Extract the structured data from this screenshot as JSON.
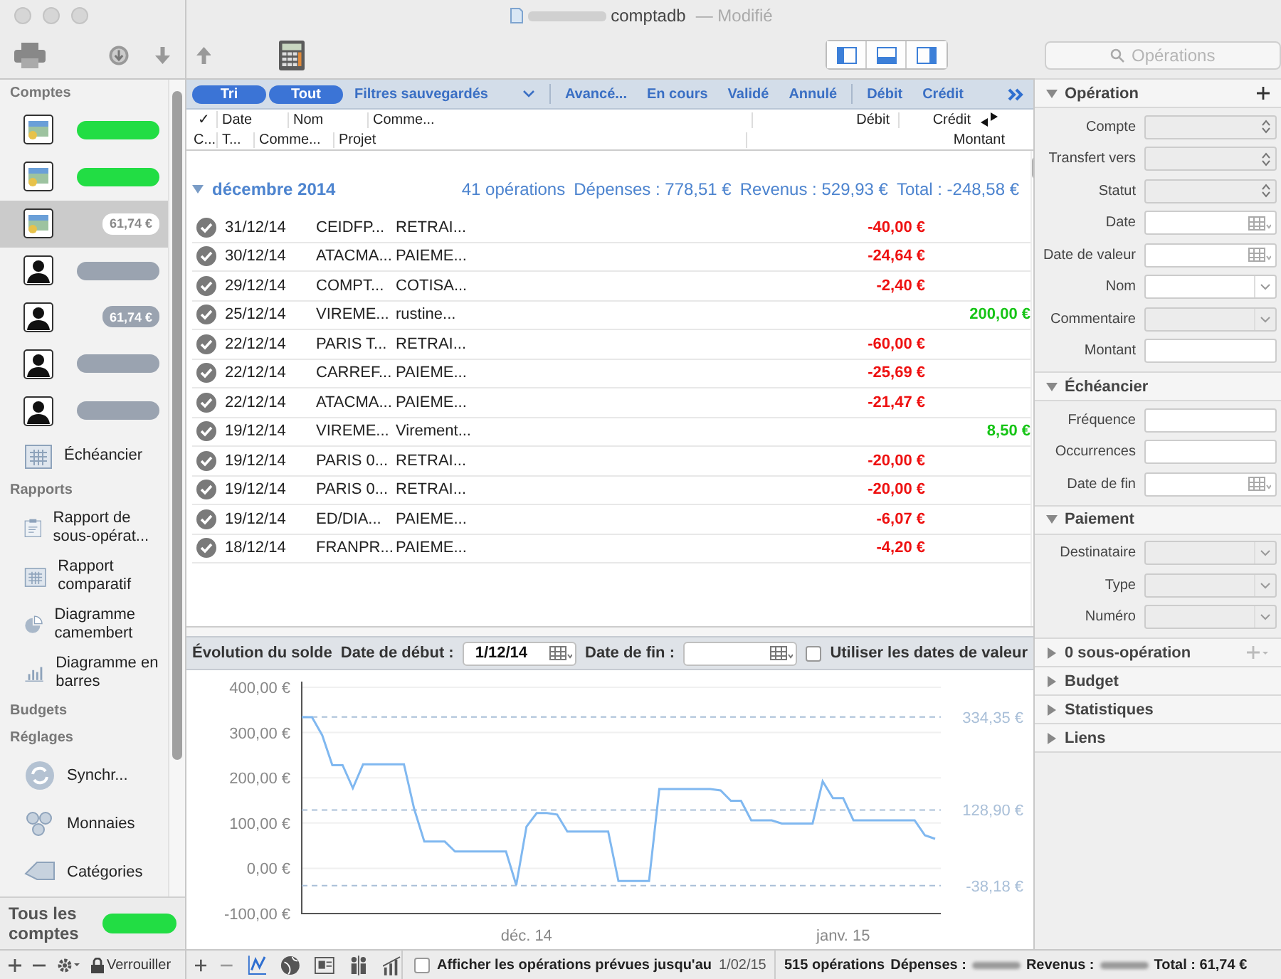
{
  "window": {
    "title": "comptadb",
    "status": "— Modifié"
  },
  "toolbar": {
    "search": {
      "placeholder": "Opérations"
    }
  },
  "sidebar": {
    "accounts_heading": "Comptes",
    "accounts": [
      {
        "kind": "card",
        "color": "#22dd44",
        "selected": false
      },
      {
        "kind": "card",
        "color": "#22dd44",
        "selected": false
      },
      {
        "kind": "card",
        "color": "#ffffff",
        "amount": "61,74 €",
        "selected": true
      },
      {
        "kind": "person",
        "color": "#9aa3b0",
        "selected": false
      },
      {
        "kind": "person",
        "color": "#9aa3b0",
        "amount": "61,74 €",
        "selected": false
      },
      {
        "kind": "person",
        "color": "#9aa3b0",
        "selected": false
      },
      {
        "kind": "person",
        "color": "#9aa3b0",
        "selected": false
      }
    ],
    "schedule": {
      "label": "Échéancier"
    },
    "groups": [
      {
        "heading": "Rapports",
        "items": [
          {
            "kind": "clipboard",
            "label": "Rapport de sous-opérat..."
          },
          {
            "kind": "calendar",
            "label": "Rapport comparatif"
          },
          {
            "kind": "pie",
            "label": "Diagramme camembert"
          },
          {
            "kind": "bars",
            "label": "Diagramme en barres"
          }
        ]
      },
      {
        "heading": "Budgets"
      },
      {
        "heading": "Réglages",
        "items": [
          {
            "kind": "sync",
            "label": "Synchr..."
          },
          {
            "kind": "coins",
            "label": "Monnaies"
          },
          {
            "kind": "tag",
            "label": "Catégories"
          }
        ]
      }
    ],
    "all_accounts": {
      "label": "Tous les comptes",
      "color": "#22dd44"
    },
    "lock_label": "Verrouiller"
  },
  "filters": [
    {
      "kind": "pill",
      "label": "Tri",
      "selected": true
    },
    {
      "kind": "pill",
      "label": "Tout",
      "selected": true
    },
    {
      "kind": "menu",
      "label": "Filtres sauvegardés",
      "selected": false
    },
    {
      "kind": "text",
      "label": "Avancé...",
      "selected": false
    },
    {
      "kind": "text",
      "label": "En cours",
      "selected": false
    },
    {
      "kind": "text",
      "label": "Validé",
      "selected": false
    },
    {
      "kind": "text",
      "label": "Annulé",
      "selected": false
    },
    {
      "kind": "text",
      "label": "Débit",
      "selected": false
    },
    {
      "kind": "text",
      "label": "Crédit",
      "selected": false
    }
  ],
  "table": {
    "header_row_1": [
      "✓",
      "Date",
      "Nom",
      "Comme...",
      "Débit",
      "Crédit"
    ],
    "header_row_2": [
      "C...",
      "T...",
      "Comme...",
      "Projet",
      "Montant"
    ],
    "group": {
      "label": "décembre 2014",
      "expanded": true,
      "count": "41 opérations",
      "expenses": "Dépenses : 778,51 €",
      "income": "Revenus : 529,93 €",
      "total": "Total : -248,58 €"
    },
    "rows": [
      {
        "validated": true,
        "date": "31/12/14",
        "name": "CEIDFP...",
        "comment": "RETRAI...",
        "debit": "-40,00 €"
      },
      {
        "validated": true,
        "date": "30/12/14",
        "name": "ATACMA...",
        "comment": "PAIEME...",
        "debit": "-24,64 €"
      },
      {
        "validated": true,
        "date": "29/12/14",
        "name": "COMPT...",
        "comment": "COTISA...",
        "debit": "-2,40 €"
      },
      {
        "validated": true,
        "date": "25/12/14",
        "name": "VIREME...",
        "comment": "rustine...",
        "credit": "200,00 €"
      },
      {
        "validated": true,
        "date": "22/12/14",
        "name": "PARIS T...",
        "comment": "RETRAI...",
        "debit": "-60,00 €"
      },
      {
        "validated": true,
        "date": "22/12/14",
        "name": "CARREF...",
        "comment": "PAIEME...",
        "debit": "-25,69 €"
      },
      {
        "validated": true,
        "date": "22/12/14",
        "name": "ATACMA...",
        "comment": "PAIEME...",
        "debit": "-21,47 €"
      },
      {
        "validated": true,
        "date": "19/12/14",
        "name": "VIREME...",
        "comment": "Virement...",
        "credit": "8,50 €"
      },
      {
        "validated": true,
        "date": "19/12/14",
        "name": "PARIS 0...",
        "comment": "RETRAI...",
        "debit": "-20,00 €"
      },
      {
        "validated": true,
        "date": "19/12/14",
        "name": "PARIS 0...",
        "comment": "RETRAI...",
        "debit": "-20,00 €"
      },
      {
        "validated": true,
        "date": "19/12/14",
        "name": "ED/DIA...",
        "comment": "PAIEME...",
        "debit": "-6,07 €"
      },
      {
        "validated": true,
        "date": "18/12/14",
        "name": "FRANPR...",
        "comment": "PAIEME...",
        "debit": "-4,20 €"
      }
    ]
  },
  "balance": {
    "title": "Évolution du solde",
    "start_label": "Date de début :",
    "start_value": "1/12/14",
    "end_label": "Date de fin :",
    "value_dates": {
      "label": "Utiliser les dates de valeur",
      "checked": false
    },
    "chart_data": {
      "type": "line",
      "categories": [
        null,
        null,
        null,
        null,
        null,
        null,
        null,
        null,
        null,
        null,
        null,
        null,
        null,
        null,
        null,
        null,
        null,
        null,
        null,
        null,
        null,
        null,
        "déc. 14",
        null,
        null,
        null,
        null,
        null,
        null,
        null,
        null,
        null,
        null,
        null,
        null,
        null,
        null,
        null,
        null,
        null,
        null,
        null,
        null,
        null,
        null,
        null,
        null,
        null,
        null,
        null,
        null,
        null,
        null,
        "janv. 15",
        null,
        null,
        null,
        null,
        null,
        null,
        null,
        null,
        null
      ],
      "series": [
        {
          "color": "#80b8f0",
          "values": [
            334,
            334,
            294,
            228,
            228,
            177,
            230,
            230,
            230,
            230,
            230,
            131,
            59,
            59,
            59,
            37,
            37,
            37,
            37,
            37,
            37,
            -37,
            92,
            122,
            122,
            119,
            81,
            81,
            81,
            81,
            81,
            -28,
            -28,
            -28,
            -28,
            175,
            175,
            175,
            175,
            175,
            175,
            172,
            149,
            149,
            106,
            106,
            106,
            99,
            99,
            99,
            99,
            192,
            155,
            155,
            106,
            106,
            106,
            106,
            106,
            106,
            106,
            73,
            65
          ]
        }
      ],
      "ylim": [
        -100,
        400
      ],
      "yticks": [
        {
          "value": 400,
          "label": "400,00 €"
        },
        {
          "value": 300,
          "label": "300,00 €"
        },
        {
          "value": 200,
          "label": "200,00 €"
        },
        {
          "value": 100,
          "label": "100,00 €"
        },
        {
          "value": 0,
          "label": "0,00 €"
        },
        {
          "value": -100,
          "label": "-100,00 €"
        }
      ],
      "grid": true,
      "ref_lines": [
        {
          "axis": "y",
          "value": 334.35,
          "label": "334,35 €",
          "color": "#a9bfd8"
        },
        {
          "axis": "y",
          "value": 128.9,
          "label": "128,90 €",
          "color": "#a9bfd8"
        },
        {
          "axis": "y",
          "value": -38.18,
          "label": "-38,18 €",
          "color": "#a9bfd8"
        }
      ]
    }
  },
  "chart_modes": [
    {
      "kind": "line",
      "selected": true
    },
    {
      "kind": "globe",
      "selected": false
    },
    {
      "kind": "card",
      "selected": false
    },
    {
      "kind": "people",
      "selected": false
    },
    {
      "kind": "bars",
      "selected": false
    }
  ],
  "bottom_bar": {
    "forecast": {
      "label": "Afficher les opérations prévues jusqu'au",
      "date": "1/02/15",
      "checked": false
    },
    "count": "515 opérations",
    "expenses_label": "Dépenses :",
    "income_label": "Revenus :",
    "total": "Total : 61,74 €"
  },
  "inspector": {
    "sections": [
      {
        "title": "Opération",
        "expanded": true,
        "add": {
          "menu": false,
          "disabled": false
        },
        "fields": [
          {
            "label": "Compte",
            "kind": "stepper",
            "disabled": true
          },
          {
            "label": "Transfert vers",
            "kind": "stepper",
            "disabled": true
          },
          {
            "label": "Statut",
            "kind": "stepper",
            "disabled": true
          },
          {
            "label": "Date",
            "kind": "date",
            "disabled": false
          },
          {
            "label": "Date de valeur",
            "kind": "date",
            "disabled": false
          },
          {
            "label": "Nom",
            "kind": "combo",
            "disabled": false
          },
          {
            "label": "Commentaire",
            "kind": "combo",
            "disabled": true
          },
          {
            "label": "Montant",
            "kind": "text",
            "disabled": false
          }
        ]
      },
      {
        "title": "Échéancier",
        "expanded": true,
        "fields": [
          {
            "label": "Fréquence",
            "kind": "text",
            "disabled": false
          },
          {
            "label": "Occurrences",
            "kind": "text",
            "disabled": false
          },
          {
            "label": "Date de fin",
            "kind": "date",
            "disabled": false
          }
        ]
      },
      {
        "title": "Paiement",
        "expanded": true,
        "fields": [
          {
            "label": "Destinataire",
            "kind": "combo",
            "disabled": true
          },
          {
            "label": "Type",
            "kind": "combo",
            "disabled": true
          },
          {
            "label": "Numéro",
            "kind": "combo",
            "disabled": true
          }
        ]
      },
      {
        "title": "0 sous-opération",
        "expanded": false,
        "add": {
          "menu": true,
          "disabled": true
        }
      },
      {
        "title": "Budget",
        "expanded": false
      },
      {
        "title": "Statistiques",
        "expanded": false
      },
      {
        "title": "Liens",
        "expanded": false
      }
    ]
  }
}
